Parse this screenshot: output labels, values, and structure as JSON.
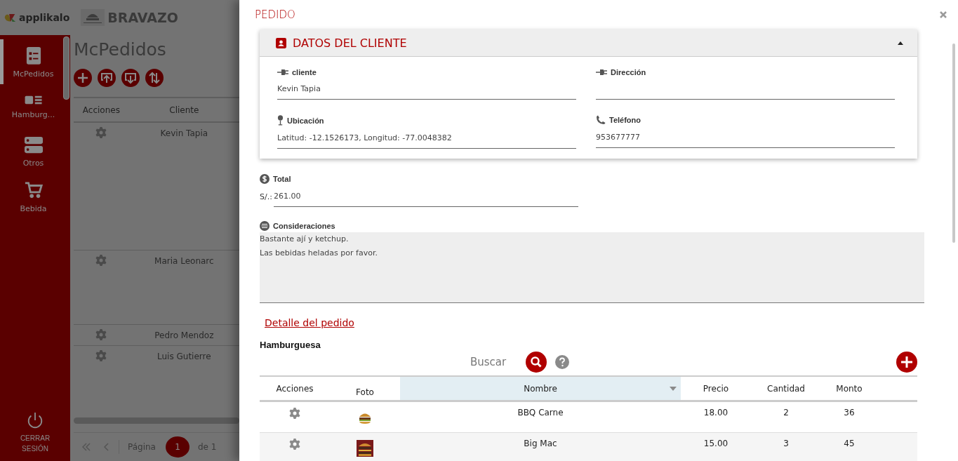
{
  "brand": {
    "app_name": "applikalo",
    "store_name": "BRAVAZO"
  },
  "sidebar": {
    "items": [
      {
        "label": "McPedidos",
        "kind": "checklist",
        "selected": true
      },
      {
        "label": "Hamburg...",
        "kind": "gallery",
        "selected": false
      },
      {
        "label": "Otros",
        "kind": "server",
        "selected": false
      },
      {
        "label": "Bebida",
        "kind": "cart",
        "selected": false
      }
    ],
    "logout": "CERRAR SESIÓN"
  },
  "page": {
    "title": "McPedidos",
    "columns": [
      "Acciones",
      "Cliente"
    ],
    "rows": [
      {
        "cliente": "Kevin Tapia"
      },
      {
        "cliente": "Maria Leonarc"
      },
      {
        "cliente": "Pedro Mendoz"
      },
      {
        "cliente": "Luis Gutierre"
      }
    ],
    "pager": {
      "label": "Página",
      "current": "1",
      "of": "de 1"
    }
  },
  "modal": {
    "title": "PEDIDO",
    "client_section": {
      "title": "DATOS DEL CLIENTE",
      "expanded": true,
      "fields": [
        {
          "label": "cliente",
          "kind": "plug",
          "value": "Kevin Tapia"
        },
        {
          "label": "Dirección",
          "kind": "plug"
        },
        {
          "label": "Ubicación",
          "kind": "pin",
          "value": "Latitud: -12.1526173, Longitud: -77.0048382"
        },
        {
          "label": "Teléfono",
          "kind": "phone",
          "value": "953677777"
        }
      ]
    },
    "total": {
      "label": "Total",
      "prefix": "S/.:",
      "value": "261.00"
    },
    "notes": {
      "label": "Consideraciones",
      "value": "Bastante ají y ketchup.\nLas bebidas heladas por favor."
    },
    "detail_link": "Detalle del pedido",
    "detail": {
      "title": "Hamburguesa",
      "search": {
        "placeholder": "Buscar"
      },
      "columns": [
        {
          "label": "Acciones",
          "sorted": false
        },
        {
          "label": "Foto",
          "sorted": false
        },
        {
          "label": "Nombre",
          "sorted": true
        },
        {
          "label": "Precio",
          "sorted": false
        },
        {
          "label": "Cantidad",
          "sorted": false
        },
        {
          "label": "Monto",
          "sorted": false
        }
      ],
      "rows": [
        {
          "nombre": "BBQ Carne",
          "precio": "18.00",
          "cantidad": "2",
          "monto": "36"
        },
        {
          "nombre": "Big Mac",
          "precio": "15.00",
          "cantidad": "3",
          "monto": "45"
        }
      ]
    }
  }
}
